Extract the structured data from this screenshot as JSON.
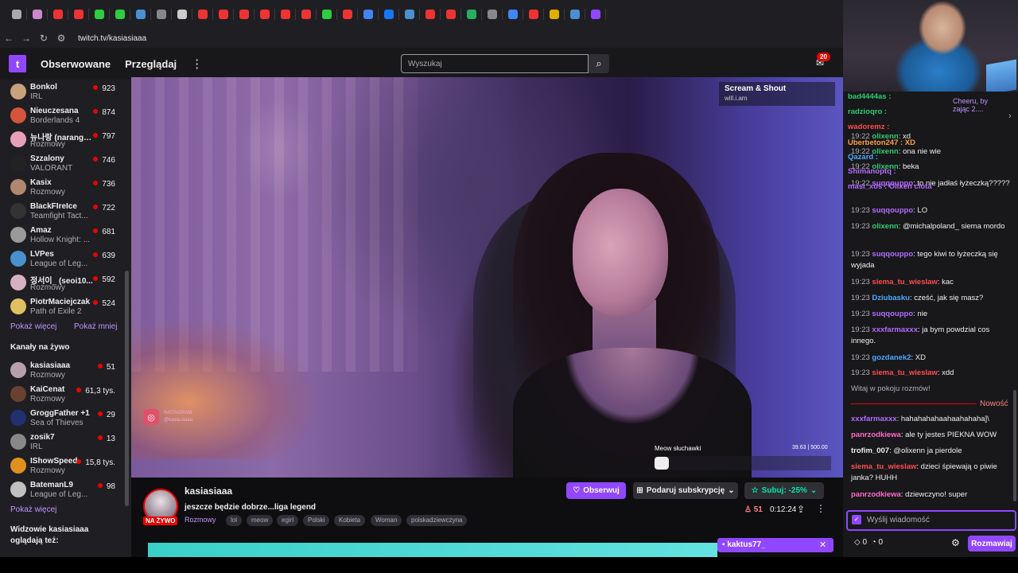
{
  "browser": {
    "tab_icons": [
      "Y",
      "T",
      "Y",
      "Q",
      "K",
      "K",
      "V",
      "G",
      "X",
      "P",
      "Q",
      "Q",
      "Q",
      "Q",
      "Q",
      "K",
      "Q",
      "G",
      "F",
      "V",
      "B",
      "Y",
      "D",
      "C",
      "G",
      "Q",
      "V",
      "C",
      "T"
    ],
    "url": "twitch.tv/kasiasiaaa"
  },
  "topnav": {
    "logo": "t",
    "following": "Obserwowane",
    "browse": "Przeglądaj",
    "more": "⋮",
    "search_placeholder": "Wyszukaj",
    "notif_count": "20"
  },
  "sidebar": {
    "followed": [
      {
        "name": "Bonkol",
        "category": "IRL",
        "viewers": "923",
        "color": "#c9a27b"
      },
      {
        "name": "Nieuczesana",
        "category": "Borderlands 4",
        "viewers": "874",
        "color": "#d4553c"
      },
      {
        "name": "뉴나랑 (narang_...",
        "category": "Rozmowy",
        "viewers": "797",
        "color": "#e8a0b8"
      },
      {
        "name": "Szzalony",
        "category": "VALORANT",
        "viewers": "746",
        "color": "#222"
      },
      {
        "name": "Kasix",
        "category": "Rozmowy",
        "viewers": "736",
        "color": "#b08870"
      },
      {
        "name": "BlackFIreIce",
        "category": "Teamfight Tact...",
        "viewers": "722",
        "color": "#333"
      },
      {
        "name": "Amaz",
        "category": "Hollow Knight: ...",
        "viewers": "681",
        "color": "#9a9a9a"
      },
      {
        "name": "LVPes",
        "category": "League of Leg...",
        "viewers": "639",
        "color": "#4a90d0"
      },
      {
        "name": "정서이_ (seoi10...",
        "category": "Rozmowy",
        "viewers": "592",
        "color": "#d6b0c2"
      },
      {
        "name": "PiotrMaciejczak",
        "category": "Path of Exile 2",
        "viewers": "524",
        "color": "#e0c060"
      }
    ],
    "show_more": "Pokaż więcej",
    "show_less": "Pokaż mniej",
    "live_header": "Kanały na żywo",
    "live": [
      {
        "name": "kasiasiaaa",
        "category": "Rozmowy",
        "viewers": "51",
        "color": "#b8a0aa"
      },
      {
        "name": "KaiCenat",
        "category": "Rozmowy",
        "viewers": "61,3 tys.",
        "color": "#6a4030"
      },
      {
        "name": "GroggFather +1",
        "category": "Sea of Thieves",
        "viewers": "29",
        "color": "#203070"
      },
      {
        "name": "zosik7",
        "category": "IRL",
        "viewers": "13",
        "color": "#888"
      },
      {
        "name": "IShowSpeed",
        "category": "Rozmowy",
        "viewers": "15,8 tys.",
        "color": "#e09020"
      },
      {
        "name": "BatemanL9",
        "category": "League of Leg...",
        "viewers": "98",
        "color": "#c0c0c0"
      }
    ],
    "show_more_2": "Pokaż więcej",
    "also_watch": "Widzowie kasiasiaaa oglądają też:"
  },
  "video": {
    "ig_label": "INSTAGRAM",
    "ig_handle": "@kasia.siaaa",
    "now_playing_title": "Scream & Shout",
    "now_playing_artist": "will.i.am",
    "sfx_label": "Meow słuchawki",
    "sfx_count": "39.63 | 500.00",
    "sfx_progress": 0.08
  },
  "channel": {
    "name": "kasiasiaaa",
    "live": "NA ŻYWO",
    "title": "jeszcze będzie dobrze...liga legend",
    "category": "Rozmowy",
    "tags": [
      "lol",
      "meow",
      "egirl",
      "Polski",
      "Kobieta",
      "Woman",
      "polskadziewczyna"
    ],
    "follow": "Obserwuj",
    "gift_sub": "Podaruj subskrypcję",
    "subscribe": "Subuj: -25%",
    "viewers": "51",
    "uptime": "0:12:24",
    "gift_user": "kaktus77_"
  },
  "chat": {
    "top_users": [
      {
        "name": "bad4444as :",
        "color": "#2ecc71"
      },
      {
        "name": "radzioqro :",
        "color": "#2ecc71"
      },
      {
        "name": "wadoremz :",
        "color": "#ff4d4d"
      },
      {
        "name": "Uberbeton247 : XD",
        "color": "#ff9f43"
      },
      {
        "name": "Qazard :",
        "color": "#4ea8ff"
      },
      {
        "name": "Shimanoptq :",
        "color": "#b36bff"
      },
      {
        "name": "masi_xos : Olixen ciota",
        "color": "#b36bff"
      }
    ],
    "top_right": "Cheeru, by zając 2....",
    "messages": [
      {
        "ts": "19:22",
        "user": "olixenn",
        "color": "#2ecc71",
        "text": ": xd"
      },
      {
        "ts": "19:22",
        "user": "olixenn",
        "color": "#2ecc71",
        "text": ": ona nie wie"
      },
      {
        "ts": "19:22",
        "user": "olixenn",
        "color": "#2ecc71",
        "text": ": beka"
      },
      {
        "ts": "19:22",
        "user": "suqqouppo",
        "color": "#b36bff",
        "text": ": to nie jadłaś łyżeczką?????"
      },
      {
        "ts": "19:23",
        "user": "suqqouppo",
        "color": "#b36bff",
        "text": ": LO"
      },
      {
        "ts": "19:23",
        "user": "olixenn",
        "color": "#2ecc71",
        "text": ": @michalpoland_ siema mordo"
      },
      {
        "ts": "19:23",
        "user": "suqqouppo",
        "color": "#b36bff",
        "text": ": tego kiwi to łyżeczką się wyjada"
      },
      {
        "ts": "19:23",
        "user": "siema_tu_wieslaw",
        "color": "#ff4d4d",
        "text": ": kac"
      },
      {
        "ts": "19:23",
        "user": "Dziubasku",
        "color": "#4ea8ff",
        "text": ": cześć, jak się masz?"
      },
      {
        "ts": "19:23",
        "user": "suqqouppo",
        "color": "#b36bff",
        "text": ": nie"
      },
      {
        "ts": "19:23",
        "user": "xxxfarmaxxx",
        "color": "#b36bff",
        "text": ": ja bym powdzial cos innego."
      },
      {
        "ts": "19:23",
        "user": "gozdanek2",
        "color": "#4ea8ff",
        "text": ": XD"
      },
      {
        "ts": "19:23",
        "user": "siema_tu_wieslaw",
        "color": "#ff4d4d",
        "text": ": xdd"
      }
    ],
    "welcome": "Witaj w pokoju rozmów!",
    "new_label": "Nowość",
    "new_messages": [
      {
        "user": "xxxfarmaxxx",
        "color": "#b36bff",
        "text": ": hahahahahaahaahahaha]\\"
      },
      {
        "user": "panrzodkiewa",
        "color": "#ff6bcb",
        "text": ": ale ty jestes PIEKNA WOW"
      },
      {
        "user": "trofim_007",
        "color": "#efeff1",
        "text": ": @olixenn ja pierdole"
      },
      {
        "user": "siema_tu_wieslaw",
        "color": "#ff4d4d",
        "text": ": dzieci śpiewają o piwie janka? HUHH"
      },
      {
        "user": "panrzodkiewa",
        "color": "#ff6bcb",
        "text": ": dziewczyno! super"
      }
    ],
    "input_placeholder": "Wyślij wiadomość",
    "bits": "0",
    "points": "0",
    "chat_button": "Rozmawiaj"
  },
  "colors": {
    "accent": "#9147ff",
    "live": "#eb0400",
    "link": "#bf94ff"
  }
}
